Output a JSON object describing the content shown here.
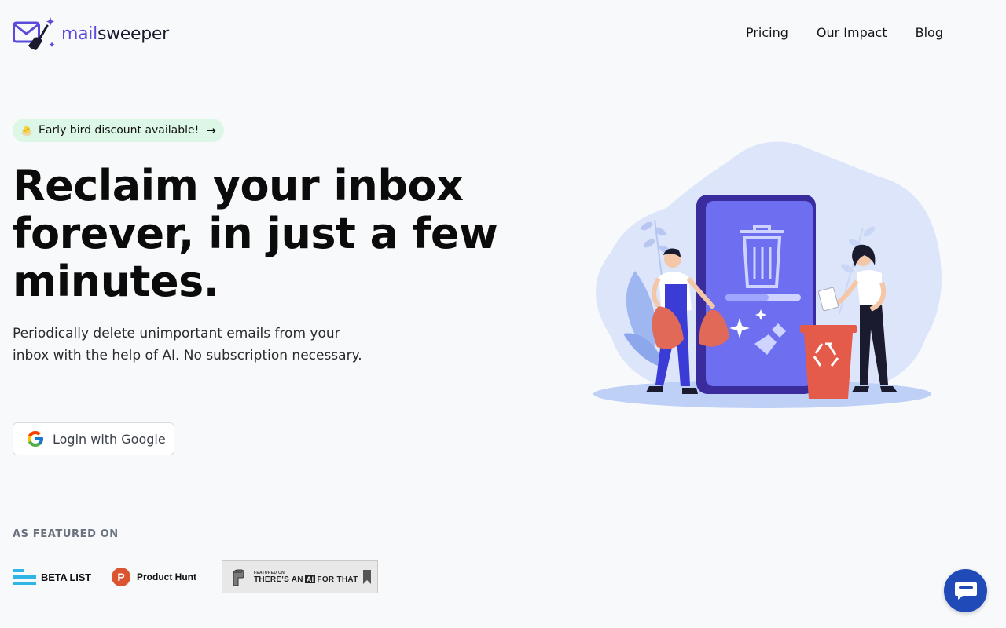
{
  "header": {
    "logo": {
      "prefix": "mail",
      "suffix": "sweeper"
    },
    "nav": [
      "Pricing",
      "Our Impact",
      "Blog"
    ]
  },
  "hero": {
    "promo": {
      "icon": "bird-emoji-icon",
      "text": "Early bird discount available!",
      "arrow": "→"
    },
    "headline": "Reclaim your inbox forever, in just a few minutes.",
    "subheadline": "Periodically delete unimportant emails from your inbox with the help of AI. No subscription necessary.",
    "cta": {
      "icon": "google-icon",
      "label": "Login with Google"
    }
  },
  "featured": {
    "title": "AS FEATURED ON",
    "items": [
      {
        "name": "BETA LIST",
        "icon": "betalist-icon"
      },
      {
        "name": "Product Hunt",
        "icon": "producthunt-icon",
        "icon_letter": "P"
      },
      {
        "small": "FEATURED ON",
        "big_prefix": "THERE'S AN",
        "big_ai": "AI",
        "big_suffix": "FOR THAT",
        "icon": "taaft-badge"
      }
    ]
  },
  "chat": {
    "icon": "chat-bubble-icon"
  },
  "colors": {
    "brand": "#5b4bdb",
    "promo_bg": "#dcf7e6",
    "chat_bg": "#1f4ab8",
    "page_bg": "#f8f9fb"
  }
}
